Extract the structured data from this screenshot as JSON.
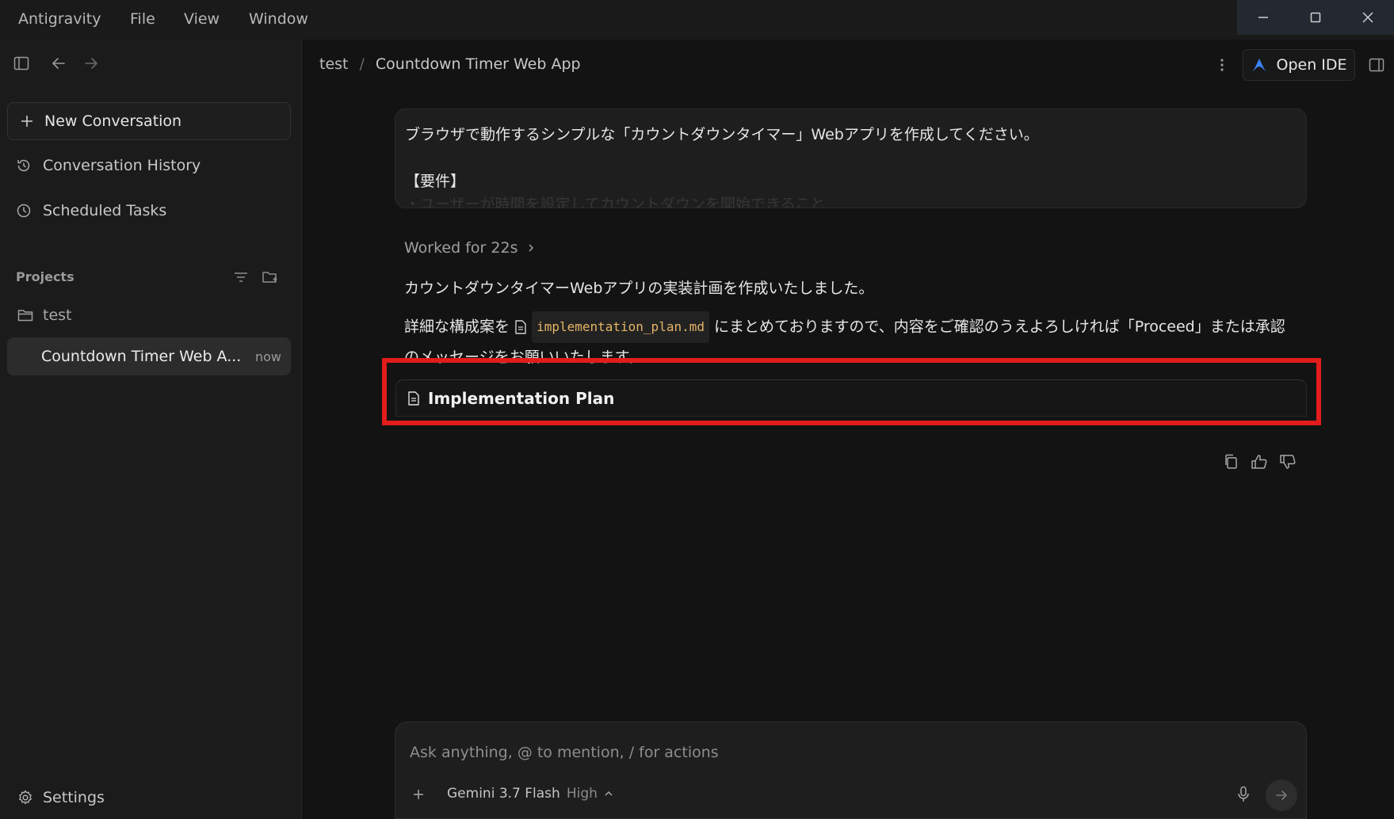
{
  "menu": {
    "app_name": "Antigravity",
    "file": "File",
    "view": "View",
    "window": "Window"
  },
  "sidebar": {
    "new_conversation": "New Conversation",
    "conversation_history": "Conversation History",
    "scheduled_tasks": "Scheduled Tasks",
    "projects_label": "Projects",
    "project_name": "test",
    "conversation_title": "Countdown Timer Web A...",
    "conversation_time": "now",
    "settings": "Settings"
  },
  "header": {
    "project": "test",
    "separator": "/",
    "title": "Countdown Timer Web App",
    "open_ide": "Open IDE"
  },
  "chat": {
    "user_message_line1": "ブラウザで動作するシンプルな「カウントダウンタイマー」Webアプリを作成してください。",
    "user_message_line2": "【要件】",
    "user_message_line3": "・ユーザーが時間を設定してカウントダウンを開始できること",
    "worked_for": "Worked for 22s",
    "response_line1": "カウントダウンタイマーWebアプリの実装計画を作成いたしました。",
    "response_line2_before": "詳細な構成案を",
    "response_file": "implementation_plan.md",
    "response_line2_after": "にまとめておりますので、内容をご確認のうえよろしければ「Proceed」または承認のメッセージをお願いいたします。",
    "plan_card_title": "Implementation Plan"
  },
  "composer": {
    "placeholder": "Ask anything, @ to mention, / for actions",
    "model": "Gemini 3.7 Flash",
    "level": "High"
  },
  "colors": {
    "background": "#131313",
    "sidebar": "#1b1b1b",
    "highlight": "#e31c1c",
    "file_link": "#e5b567",
    "ide_logo_blue": "#3b82f6"
  },
  "icons": {
    "sidebar_toggle": "sidebar-toggle-icon",
    "back": "arrow-left-icon",
    "forward": "arrow-right-icon",
    "plus": "plus-icon",
    "history": "history-icon",
    "clock": "clock-icon",
    "filter": "filter-icon",
    "new_folder": "folder-plus-icon",
    "folder": "folder-icon",
    "gear": "gear-icon",
    "kebab": "more-vertical-icon",
    "panel": "panel-right-icon",
    "document": "document-icon",
    "copy": "copy-icon",
    "thumbs_up": "thumbs-up-icon",
    "thumbs_down": "thumbs-down-icon",
    "mic": "mic-icon",
    "send": "send-arrow-icon"
  }
}
